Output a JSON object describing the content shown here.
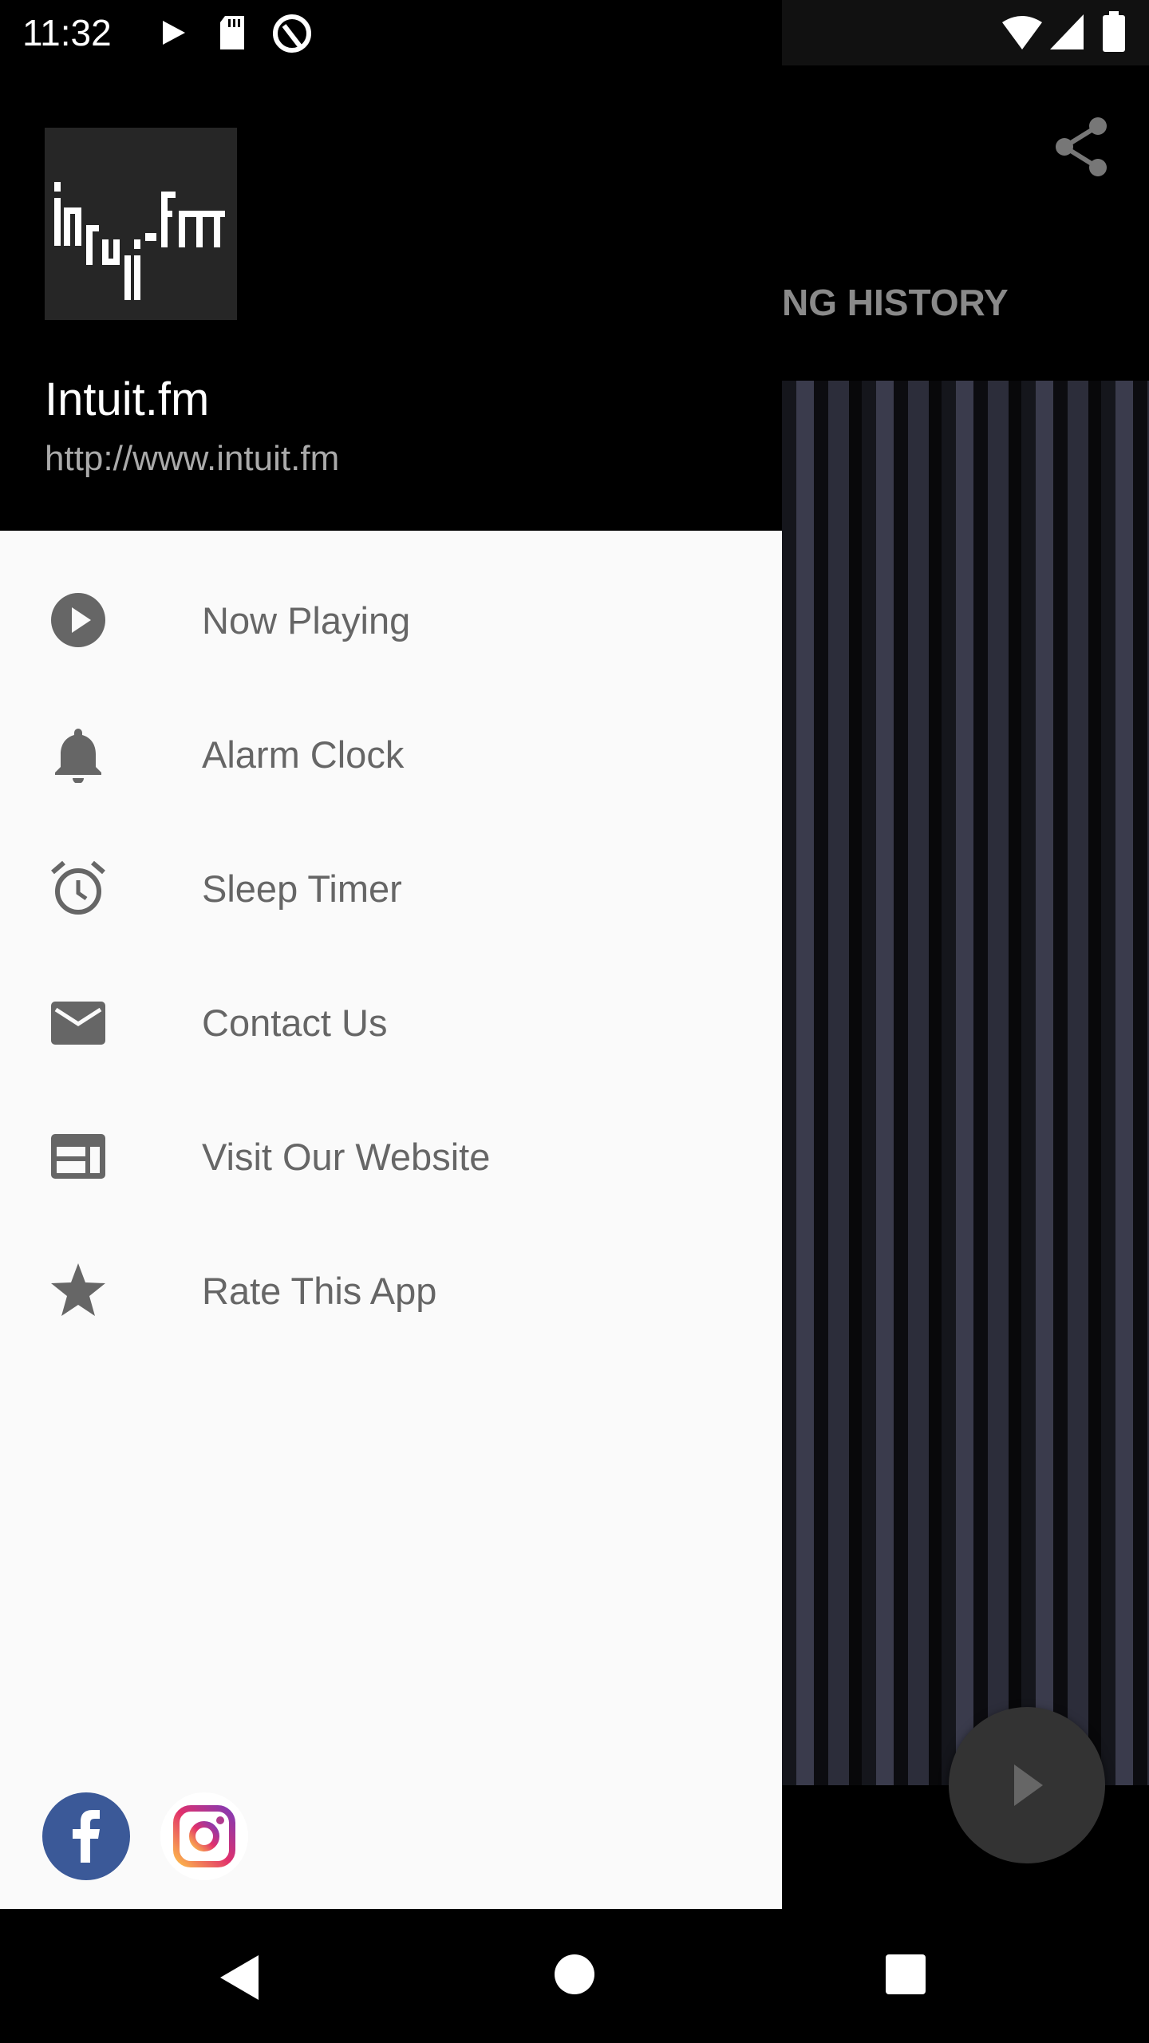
{
  "status_bar": {
    "time": "11:32"
  },
  "background": {
    "tab_label": "NG HISTORY"
  },
  "drawer": {
    "title": "Intuit.fm",
    "url": "http://www.intuit.fm",
    "logo_text": "intuit.fm",
    "items": [
      {
        "label": "Now Playing",
        "icon": "play-circle"
      },
      {
        "label": "Alarm Clock",
        "icon": "bell"
      },
      {
        "label": "Sleep Timer",
        "icon": "alarm-clock"
      },
      {
        "label": "Contact Us",
        "icon": "mail"
      },
      {
        "label": "Visit Our Website",
        "icon": "web"
      },
      {
        "label": "Rate This App",
        "icon": "star"
      }
    ],
    "social": [
      {
        "name": "facebook",
        "color": "#3b5998"
      },
      {
        "name": "instagram"
      }
    ]
  },
  "colors": {
    "drawer_bg": "#fafafa",
    "icon": "#666666",
    "fab": "#333333"
  }
}
